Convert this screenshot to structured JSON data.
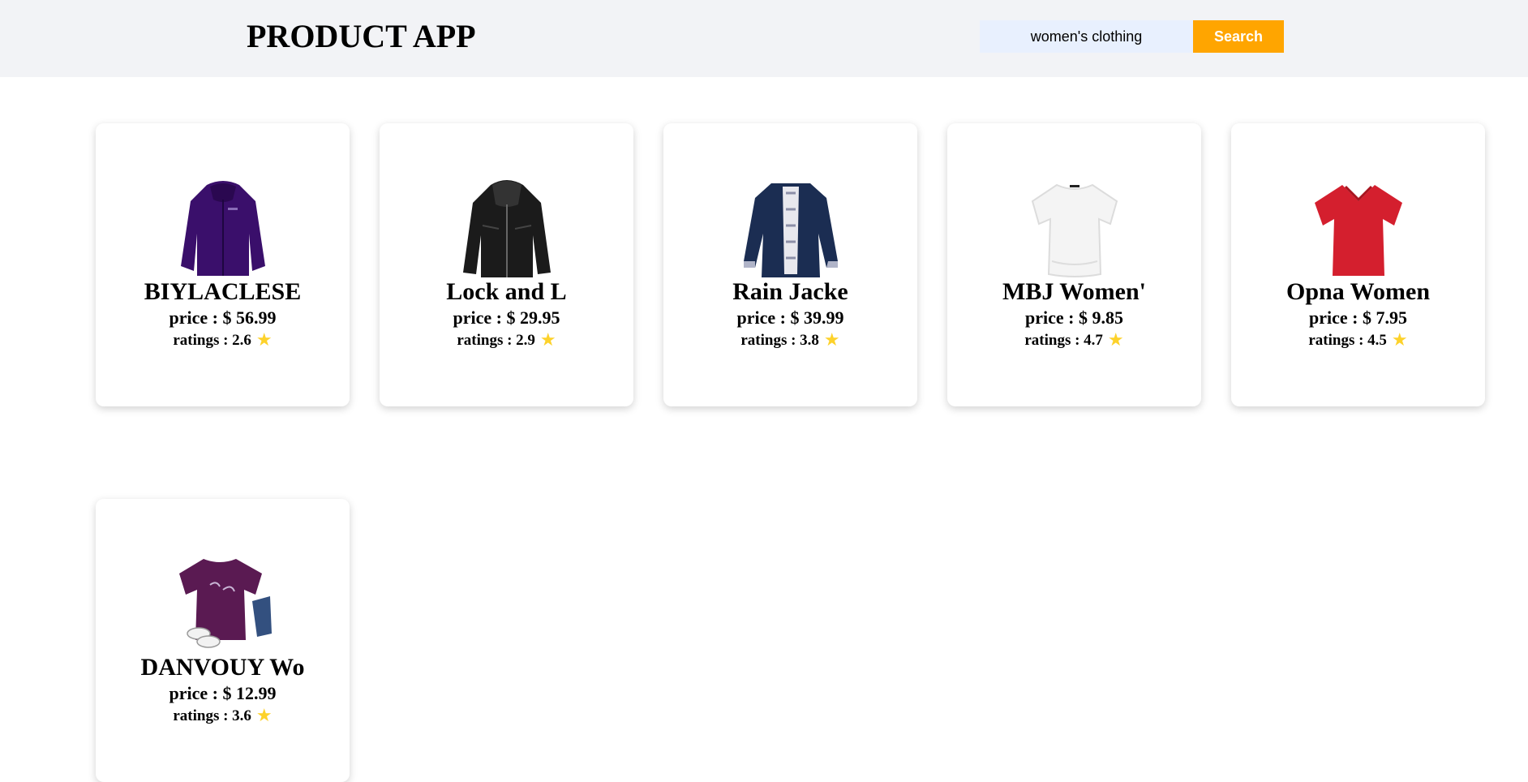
{
  "header": {
    "title": "PRODUCT APP",
    "search_value": "women's clothing",
    "search_button": "Search"
  },
  "products": [
    {
      "name": "BIYLACLESE",
      "price": "price : $ 56.99",
      "rating": "ratings : 2.6",
      "image": "purple-jacket-icon"
    },
    {
      "name": "Lock and L",
      "price": "price : $ 29.95",
      "rating": "ratings : 2.9",
      "image": "black-leather-jacket-icon"
    },
    {
      "name": "Rain Jacke",
      "price": "price : $ 39.99",
      "rating": "ratings : 3.8",
      "image": "navy-rain-jacket-icon"
    },
    {
      "name": "MBJ Women'",
      "price": "price : $ 9.85",
      "rating": "ratings : 4.7",
      "image": "white-tshirt-icon"
    },
    {
      "name": "Opna Women",
      "price": "price : $ 7.95",
      "rating": "ratings : 4.5",
      "image": "red-vneck-tshirt-icon"
    },
    {
      "name": "DANVOUY Wo",
      "price": "price : $ 12.99",
      "rating": "ratings : 3.6",
      "image": "purple-tee-outfit-icon"
    }
  ],
  "icons": {
    "star": "star-icon"
  },
  "colors": {
    "header_bg": "#f2f3f6",
    "search_bg": "#e8f0fe",
    "accent": "#ffa500",
    "star": "#fdd22b"
  }
}
